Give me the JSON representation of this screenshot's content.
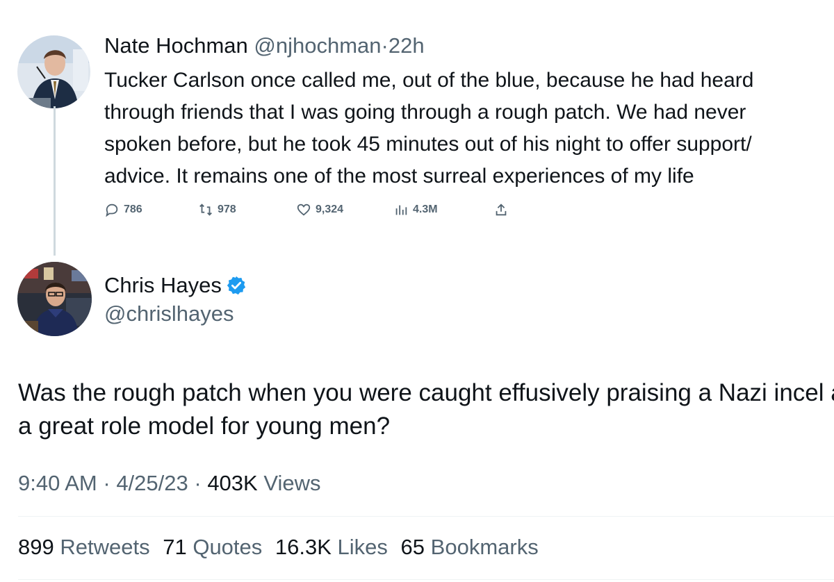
{
  "parent": {
    "name": "Nate Hochman",
    "handle": "@njhochman",
    "sep": "·",
    "time": "22h",
    "text_lines": [
      "Tucker Carlson once called me, out of the blue, because he had heard",
      "through friends that I was going through a rough patch. We had never",
      "spoken before, but he took 45 minutes out of his night to offer support/",
      "advice. It remains one of the most surreal experiences of my life"
    ],
    "actions": {
      "replies": "786",
      "retweets": "978",
      "likes": "9,324",
      "views": "4.3M"
    }
  },
  "tweet": {
    "name": "Chris Hayes",
    "handle": "@chrislhayes",
    "verified": true,
    "text_lines": [
      "Was the rough patch when you were caught effusively praising a Nazi incel as",
      "a great role model for young men?"
    ],
    "meta": {
      "time": "9:40 AM",
      "sep1": " · ",
      "date": "4/25/23",
      "sep2": " · ",
      "views_count": "403K",
      "views_label": " Views"
    },
    "stats": {
      "retweets_count": "899",
      "retweets_label": "Retweets",
      "quotes_count": "71",
      "quotes_label": "Quotes",
      "likes_count": "16.3K",
      "likes_label": "Likes",
      "bookmarks_count": "65",
      "bookmarks_label": "Bookmarks"
    }
  },
  "colors": {
    "text": "#0f1419",
    "muted": "#536471",
    "verified": "#1d9bf0",
    "line": "#cfd9de"
  }
}
